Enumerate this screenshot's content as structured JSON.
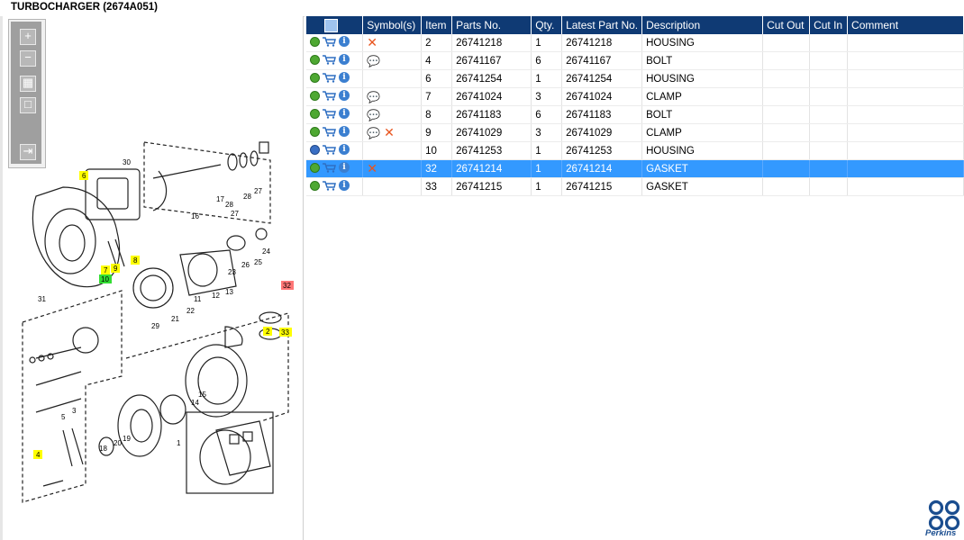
{
  "title": "TURBOCHARGER (2674A051)",
  "toolbox": {
    "zoom_in": "+",
    "zoom_out": "−",
    "fit": "▦",
    "reset": "□",
    "export": "⇥"
  },
  "table": {
    "headers": [
      "",
      "Symbol(s)",
      "Item",
      "Parts No.",
      "Qty.",
      "Latest Part No.",
      "Description",
      "Cut Out",
      "Cut In",
      "Comment"
    ],
    "rows": [
      {
        "symbols": "✕",
        "item": "2",
        "parts_no": "26741218",
        "qty": "1",
        "latest": "26741218",
        "desc": "HOUSING"
      },
      {
        "symbols": "💬",
        "item": "4",
        "parts_no": "26741167",
        "qty": "6",
        "latest": "26741167",
        "desc": "BOLT"
      },
      {
        "symbols": "",
        "item": "6",
        "parts_no": "26741254",
        "qty": "1",
        "latest": "26741254",
        "desc": "HOUSING"
      },
      {
        "symbols": "💬",
        "item": "7",
        "parts_no": "26741024",
        "qty": "3",
        "latest": "26741024",
        "desc": "CLAMP"
      },
      {
        "symbols": "💬",
        "item": "8",
        "parts_no": "26741183",
        "qty": "6",
        "latest": "26741183",
        "desc": "BOLT"
      },
      {
        "symbols": "💬 ✕",
        "item": "9",
        "parts_no": "26741029",
        "qty": "3",
        "latest": "26741029",
        "desc": "CLAMP"
      },
      {
        "symbols": "",
        "item": "10",
        "parts_no": "26741253",
        "qty": "1",
        "latest": "26741253",
        "desc": "HOUSING"
      },
      {
        "symbols": "✕",
        "item": "32",
        "parts_no": "26741214",
        "qty": "1",
        "latest": "26741214",
        "desc": "GASKET"
      },
      {
        "symbols": "",
        "item": "33",
        "parts_no": "26741215",
        "qty": "1",
        "latest": "26741215",
        "desc": "GASKET"
      }
    ]
  },
  "diagram": {
    "callouts": [
      "30",
      "6",
      "16",
      "17",
      "28",
      "27",
      "28",
      "27",
      "7",
      "8",
      "9",
      "10",
      "31",
      "23",
      "26",
      "25",
      "24",
      "12",
      "11",
      "13",
      "29",
      "21",
      "22",
      "32",
      "2",
      "33",
      "14",
      "15",
      "5",
      "3",
      "19",
      "18",
      "20",
      "4",
      "1"
    ]
  },
  "brand": "Perkins"
}
